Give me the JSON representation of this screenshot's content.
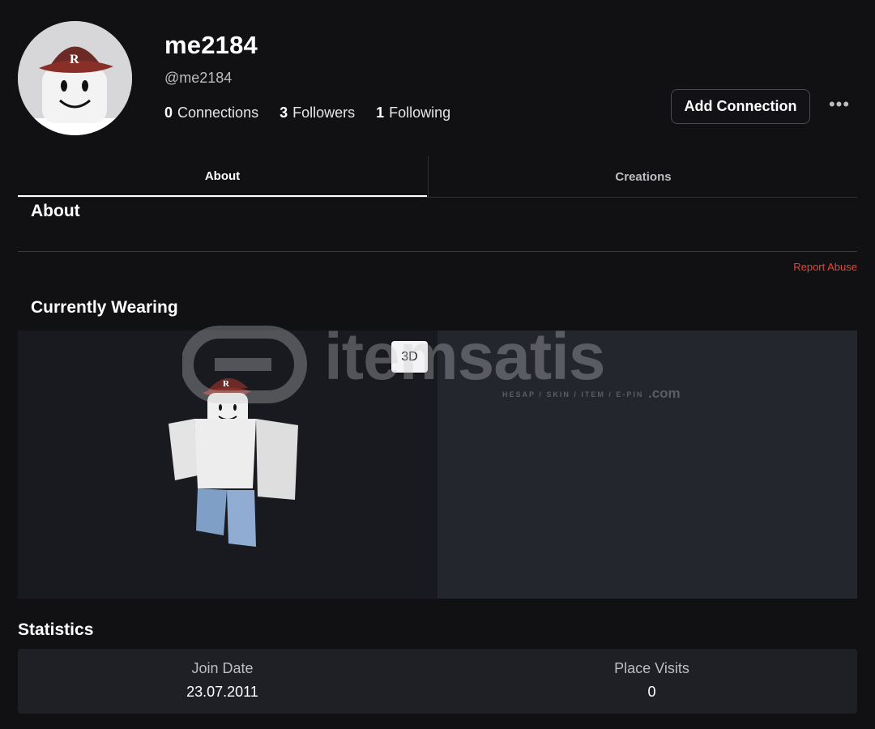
{
  "profile": {
    "display_name": "me2184",
    "handle": "@me2184",
    "connections": {
      "count": "0",
      "label": "Connections"
    },
    "followers": {
      "count": "3",
      "label": "Followers"
    },
    "following": {
      "count": "1",
      "label": "Following"
    },
    "add_connection_label": "Add Connection",
    "more_icon": "more-horizontal-icon",
    "more_label": "•••"
  },
  "tabs": [
    {
      "label": "About",
      "active": true
    },
    {
      "label": "Creations",
      "active": false
    }
  ],
  "about": {
    "title": "About",
    "report_label": "Report Abuse"
  },
  "wearing": {
    "title": "Currently Wearing",
    "view_toggle_label": "3D"
  },
  "watermark": {
    "text": "itemsatis",
    "sub": "HESAP / SKIN / ITEM / E-PIN",
    "suffix": ".com"
  },
  "statistics": {
    "title": "Statistics",
    "items": [
      {
        "label": "Join Date",
        "value": "23.07.2011"
      },
      {
        "label": "Place Visits",
        "value": "0"
      }
    ]
  },
  "colors": {
    "background": "#111114",
    "report": "#e0483a",
    "panel": "#1f2026"
  }
}
